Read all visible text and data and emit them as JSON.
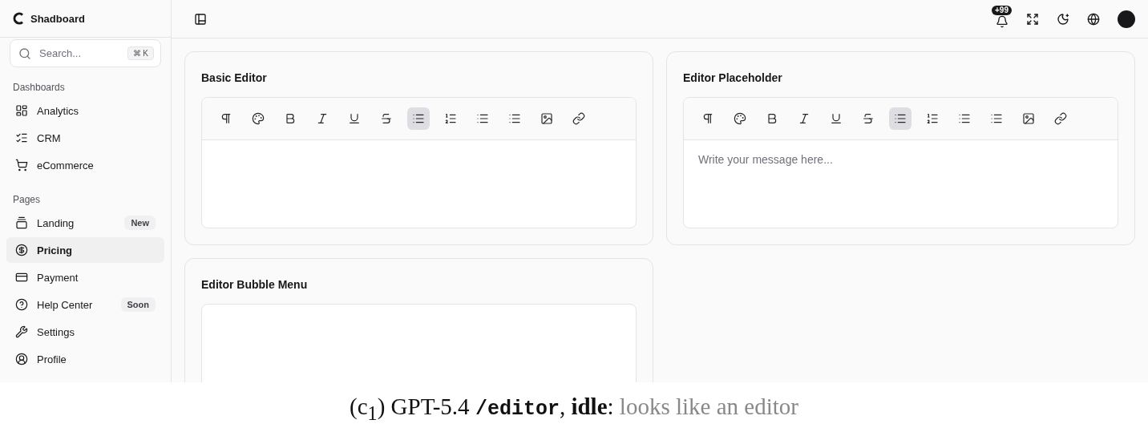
{
  "brand": {
    "name": "Shadboard"
  },
  "search": {
    "placeholder": "Search...",
    "shortcut": "⌘ K"
  },
  "sidebar": {
    "sections": [
      {
        "title": "Dashboards",
        "items": [
          {
            "label": "Analytics",
            "kind": "analytics",
            "selected": false
          },
          {
            "label": "CRM",
            "kind": "crm",
            "selected": false
          },
          {
            "label": "eCommerce",
            "kind": "ecommerce",
            "selected": false
          }
        ]
      },
      {
        "title": "Pages",
        "items": [
          {
            "label": "Landing",
            "kind": "landing",
            "badge": "New",
            "selected": false
          },
          {
            "label": "Pricing",
            "kind": "pricing",
            "selected": true
          },
          {
            "label": "Payment",
            "kind": "payment",
            "selected": false
          },
          {
            "label": "Help Center",
            "kind": "help",
            "badge": "Soon",
            "selected": false
          },
          {
            "label": "Settings",
            "kind": "settings",
            "selected": false
          },
          {
            "label": "Profile",
            "kind": "profile",
            "selected": false
          }
        ]
      }
    ]
  },
  "header": {
    "notification_count": "+99"
  },
  "editors": [
    {
      "title": "Basic Editor",
      "kind": "toolbar"
    },
    {
      "title": "Editor Placeholder",
      "kind": "toolbar",
      "placeholder": "Write your message here..."
    },
    {
      "title": "Editor Bubble Menu",
      "kind": "bubble"
    }
  ],
  "toolbar": [
    {
      "kind": "paragraph",
      "selected": false
    },
    {
      "kind": "color",
      "selected": false
    },
    {
      "kind": "bold",
      "selected": false
    },
    {
      "kind": "italic",
      "selected": false
    },
    {
      "kind": "underline",
      "selected": false
    },
    {
      "kind": "strike",
      "selected": false
    },
    {
      "kind": "bullet",
      "selected": true
    },
    {
      "kind": "ordered",
      "selected": false
    },
    {
      "kind": "list",
      "selected": false
    },
    {
      "kind": "list",
      "selected": false
    },
    {
      "kind": "image",
      "selected": false
    },
    {
      "kind": "link",
      "selected": false
    }
  ],
  "caption": [
    {
      "kind": "plain",
      "text": "(c$_{1}$) GPT-5.4 "
    },
    {
      "kind": "code",
      "text": "/editor"
    },
    {
      "kind": "plain",
      "text": ", "
    },
    {
      "kind": "bold",
      "text": "idle"
    },
    {
      "kind": "plain",
      "text": ": "
    },
    {
      "kind": "muted",
      "text": "looks like an editor"
    }
  ]
}
